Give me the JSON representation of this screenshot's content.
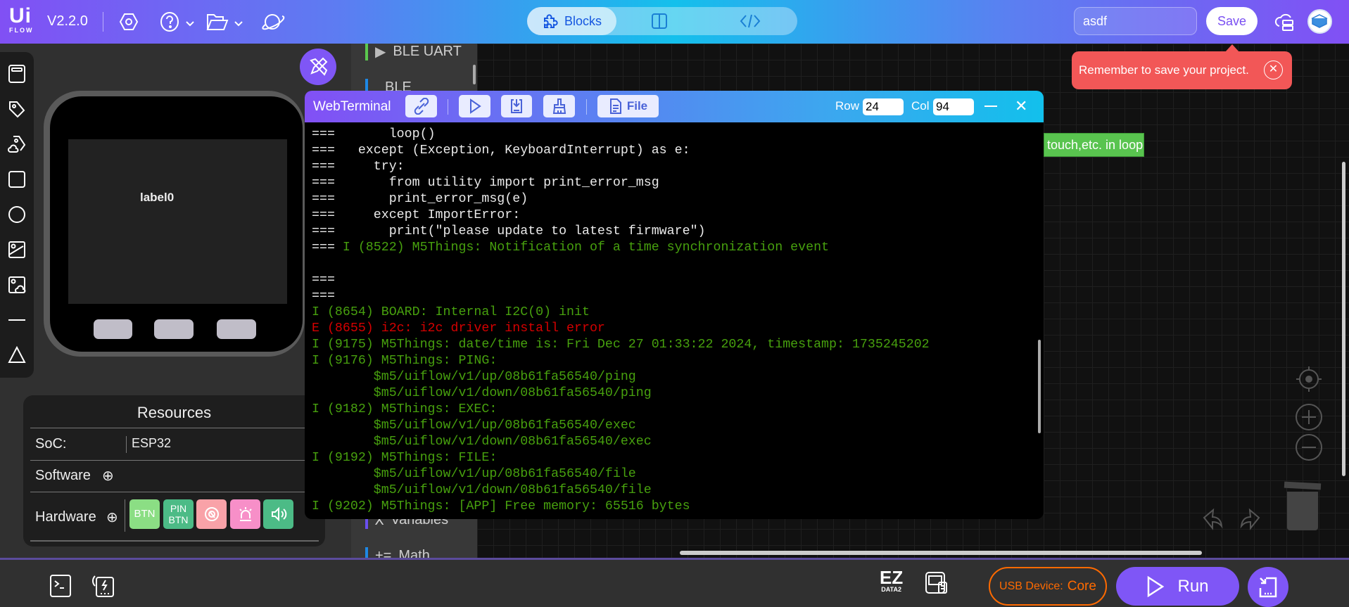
{
  "header": {
    "logo_text": "UiFLOW",
    "version": "V2.2.0",
    "tabs": [
      {
        "label": "Blocks",
        "icon": "puzzle-icon",
        "active": true
      },
      {
        "label": "",
        "icon": "split-view-icon"
      },
      {
        "label": "",
        "icon": "code-icon"
      }
    ],
    "project_name": "asdf",
    "save_label": "Save"
  },
  "toast": {
    "message": "Remember to save your project.",
    "color": "#f25757"
  },
  "block_categories": [
    {
      "label": "BLE UART",
      "color": "#5bc84e"
    },
    {
      "label": "BLE",
      "color": "#1e88e5"
    },
    {
      "label": "Variables",
      "color": "#6a4ff0"
    },
    {
      "label": "Math",
      "color": "#1e88e5"
    }
  ],
  "canvas_block": {
    "text": "touch,etc. in loop",
    "color": "#59c44f"
  },
  "terminal": {
    "title": "WebTerminal",
    "file_label": "File",
    "row_label": "Row",
    "row_value": "24",
    "col_label": "Col",
    "col_value": "94",
    "lines": [
      {
        "p": "===",
        "t": "       loop()",
        "c": "w"
      },
      {
        "p": "===",
        "t": "   except (Exception, KeyboardInterrupt) as e:",
        "c": "w"
      },
      {
        "p": "===",
        "t": "     try:",
        "c": "w"
      },
      {
        "p": "===",
        "t": "       from utility import print_error_msg",
        "c": "w"
      },
      {
        "p": "===",
        "t": "       print_error_msg(e)",
        "c": "w"
      },
      {
        "p": "===",
        "t": "     except ImportError:",
        "c": "w"
      },
      {
        "p": "===",
        "t": "       print(\"please update to latest firmware\")",
        "c": "w"
      },
      {
        "p": "===",
        "t": " I (8522) M5Things: Notification of a time synchronization event",
        "c": "g"
      },
      {
        "p": "",
        "t": "",
        "c": "w"
      },
      {
        "p": "===",
        "t": "",
        "c": "w"
      },
      {
        "p": "===",
        "t": "",
        "c": "w"
      },
      {
        "p": "",
        "t": "I (8654) BOARD: Internal I2C(0) init",
        "c": "g"
      },
      {
        "p": "",
        "t": "E (8655) i2c: i2c driver install error",
        "c": "r"
      },
      {
        "p": "",
        "t": "I (9175) M5Things: date/time is: Fri Dec 27 01:33:22 2024, timestamp: 1735245202",
        "c": "g"
      },
      {
        "p": "",
        "t": "I (9176) M5Things: PING:",
        "c": "g"
      },
      {
        "p": "",
        "t": "        $m5/uiflow/v1/up/08b61fa56540/ping",
        "c": "g"
      },
      {
        "p": "",
        "t": "        $m5/uiflow/v1/down/08b61fa56540/ping",
        "c": "g"
      },
      {
        "p": "",
        "t": "I (9182) M5Things: EXEC:",
        "c": "g"
      },
      {
        "p": "",
        "t": "        $m5/uiflow/v1/up/08b61fa56540/exec",
        "c": "g"
      },
      {
        "p": "",
        "t": "        $m5/uiflow/v1/down/08b61fa56540/exec",
        "c": "g"
      },
      {
        "p": "",
        "t": "I (9192) M5Things: FILE:",
        "c": "g"
      },
      {
        "p": "",
        "t": "        $m5/uiflow/v1/up/08b61fa56540/file",
        "c": "g"
      },
      {
        "p": "",
        "t": "        $m5/uiflow/v1/down/08b61fa56540/file",
        "c": "g"
      },
      {
        "p": "",
        "t": "I (9202) M5Things: [APP] Free memory: 65516 bytes",
        "c": "g"
      }
    ]
  },
  "device": {
    "screen_label": "label0"
  },
  "resources": {
    "title": "Resources",
    "soc_label": "SoC:",
    "soc_value": "ESP32",
    "software_label": "Software",
    "hardware_label": "Hardware",
    "hardware_chips": [
      {
        "label": "BTN",
        "color": "#8bde84"
      },
      {
        "label": "PIN BTN",
        "color": "#4cbb86"
      },
      {
        "label": "",
        "icon": "rotary-icon",
        "color": "#f9a2a8"
      },
      {
        "label": "",
        "icon": "alarm-light-icon",
        "color": "#f78fc8"
      },
      {
        "label": "",
        "icon": "speaker-icon",
        "color": "#4cbb86"
      }
    ]
  },
  "bottombar": {
    "ez_label": "EZ",
    "ez_sub": "DATA2",
    "usb_label": "USB Device:",
    "usb_value": "Core",
    "run_label": "Run",
    "usb_color": "#ff6a00",
    "accent": "#7f56f6"
  }
}
